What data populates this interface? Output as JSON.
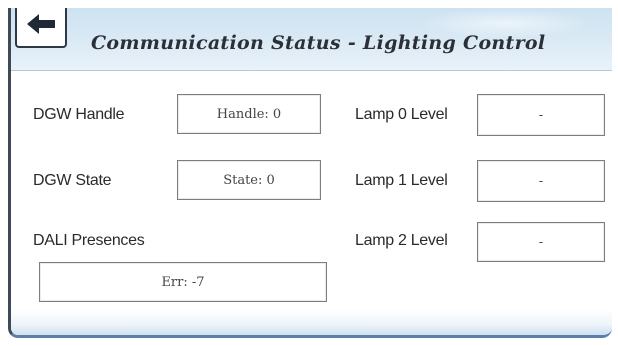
{
  "header": {
    "title": "Communication Status - Lighting Control"
  },
  "icons": {
    "back": "back-arrow-icon"
  },
  "left": {
    "dgw_handle_label": "DGW Handle",
    "dgw_handle_value": "Handle: 0",
    "dgw_state_label": "DGW State",
    "dgw_state_value": "State: 0",
    "dali_presences_label": "DALI Presences",
    "dali_presences_value": "Err: -7"
  },
  "right": {
    "lamp0_label": "Lamp 0 Level",
    "lamp0_value": "-",
    "lamp1_label": "Lamp 1 Level",
    "lamp1_value": "-",
    "lamp2_label": "Lamp 2 Level",
    "lamp2_value": "-"
  },
  "colors": {
    "header_bg": "#cde2f1",
    "frame_dark": "#3f4a57",
    "frame_accent": "#5a7fa8"
  }
}
